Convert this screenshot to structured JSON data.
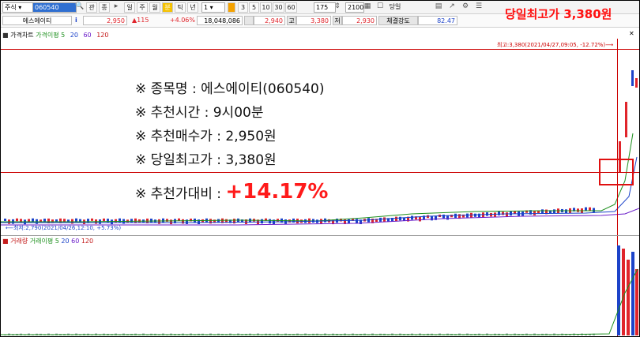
{
  "toolbar": {
    "market": "주식",
    "code": "060540",
    "tags": [
      "관",
      "종"
    ],
    "periods": [
      "일",
      "주",
      "월",
      "분",
      "틱",
      "년"
    ],
    "count_select": "1",
    "intervals": [
      "3",
      "5",
      "10",
      "30",
      "60"
    ],
    "count_value": "175",
    "view_count": "2100",
    "same_day_label": "당일"
  },
  "quote": {
    "name": "에스에이티",
    "price": "2,950",
    "change": "▲115",
    "change_rate": "+4.06%",
    "volume": "18,048,086",
    "open_value": "2,940",
    "high_label": "고",
    "high_value": "3,380",
    "low_label": "저",
    "low_value": "2,930",
    "strength_label": "체결강도",
    "strength_value": "82.47"
  },
  "highlight": "당일최고가 3,380원",
  "price_panel": {
    "title": "가격차트",
    "legend": [
      {
        "text": "가격이평 5",
        "color": "#1c8f1c"
      },
      {
        "text": "20",
        "color": "#1c43c9"
      },
      {
        "text": "60",
        "color": "#6a1cc9"
      },
      {
        "text": "120",
        "color": "#c41c1c"
      }
    ],
    "max_note": "최고:3,380(2021/04/27,09:05, -12.72%)⟶",
    "min_note": "⟵최저:2,790(2021/04/26,12:10, +5.73%)"
  },
  "volume_panel": {
    "title": "거래량",
    "legend": [
      {
        "text": "거래이평 5",
        "color": "#1c8f1c"
      },
      {
        "text": "20",
        "color": "#1c43c9"
      },
      {
        "text": "60",
        "color": "#6a1cc9"
      },
      {
        "text": "120",
        "color": "#c41c1c"
      }
    ]
  },
  "annotation": {
    "line1": "※ 종목명 : 에스에이티(060540)",
    "line2": "※ 추천시간 : 9시00분",
    "line3": "※ 추천매수가 : 2,950원",
    "line4": "※ 당일최고가 : 3,380원",
    "line5_prefix": "※ 추천가대비 : ",
    "line5_value": "+14.17%"
  },
  "colors": {
    "up": "#e0242b",
    "down": "#1c43c9",
    "accent": "#ff1a1a"
  }
}
